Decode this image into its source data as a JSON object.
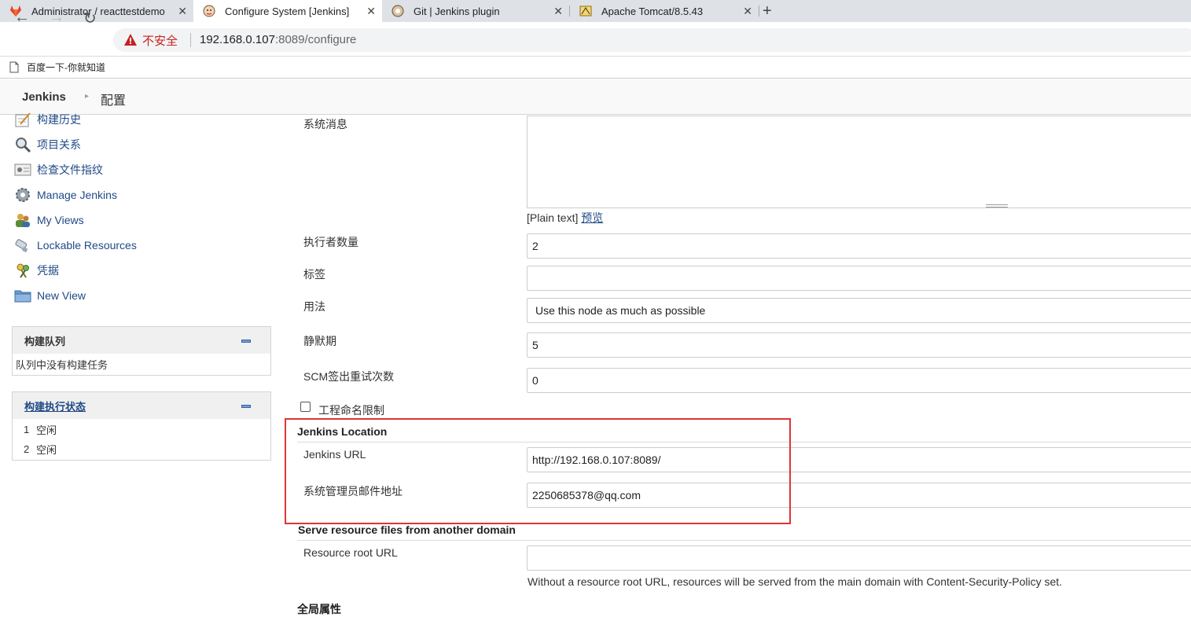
{
  "browser": {
    "tabs": [
      {
        "title": "Administrator / reacttestdemo · G",
        "favicon": "gitlab-icon",
        "active": false
      },
      {
        "title": "Configure System [Jenkins]",
        "favicon": "jenkins-icon",
        "active": true
      },
      {
        "title": "Git | Jenkins plugin",
        "favicon": "jenkins-plugin-icon",
        "active": false
      },
      {
        "title": "Apache Tomcat/8.5.43",
        "favicon": "tomcat-icon",
        "active": false
      }
    ],
    "new_tab_glyph": "+",
    "security_label": "不安全",
    "url_host": "192.168.0.107",
    "url_path": ":8089/configure",
    "bookmarks": [
      {
        "label": "百度一下-你就知道"
      }
    ]
  },
  "breadcrumb": {
    "root": "Jenkins",
    "page": "配置"
  },
  "sidebar": {
    "items": [
      {
        "label": "构建历史",
        "icon": "notepad-icon"
      },
      {
        "label": "项目关系",
        "icon": "magnifier-icon"
      },
      {
        "label": "检查文件指纹",
        "icon": "fingerprint-icon"
      },
      {
        "label": "Manage Jenkins",
        "icon": "gear-icon"
      },
      {
        "label": "My Views",
        "icon": "users-icon"
      },
      {
        "label": "Lockable Resources",
        "icon": "usb-icon"
      },
      {
        "label": "凭据",
        "icon": "keys-icon"
      },
      {
        "label": "New View",
        "icon": "folder-icon"
      }
    ],
    "queue": {
      "title": "构建队列",
      "empty_text": "队列中没有构建任务"
    },
    "executors": {
      "title": "构建执行状态",
      "rows": [
        {
          "num": "1",
          "status": "空闲"
        },
        {
          "num": "2",
          "status": "空闲"
        }
      ]
    }
  },
  "form": {
    "system_message_label": "系统消息",
    "plain_text_prefix": "[Plain text]",
    "preview_link": "预览",
    "executors_label": "执行者数量",
    "executors_value": "2",
    "labels_label": "标签",
    "labels_value": "",
    "usage_label": "用法",
    "usage_value": "Use this node as much as possible",
    "quiet_period_label": "静默期",
    "quiet_period_value": "5",
    "scm_retry_label": "SCM签出重试次数",
    "scm_retry_value": "0",
    "naming_restrict_label": "工程命名限制",
    "location_section": "Jenkins Location",
    "jenkins_url_label": "Jenkins URL",
    "jenkins_url_value": "http://192.168.0.107:8089/",
    "admin_email_label": "系统管理员邮件地址",
    "admin_email_value": "2250685378@qq.com",
    "resource_section": "Serve resource files from another domain",
    "resource_root_label": "Resource root URL",
    "resource_root_value": "",
    "resource_help": "Without a resource root URL, resources will be served from the main domain with Content-Security-Policy set.",
    "global_props_section": "全局属性"
  },
  "colors": {
    "highlight_border": "#e03434",
    "link": "#204a87",
    "warning": "#c5221f"
  }
}
